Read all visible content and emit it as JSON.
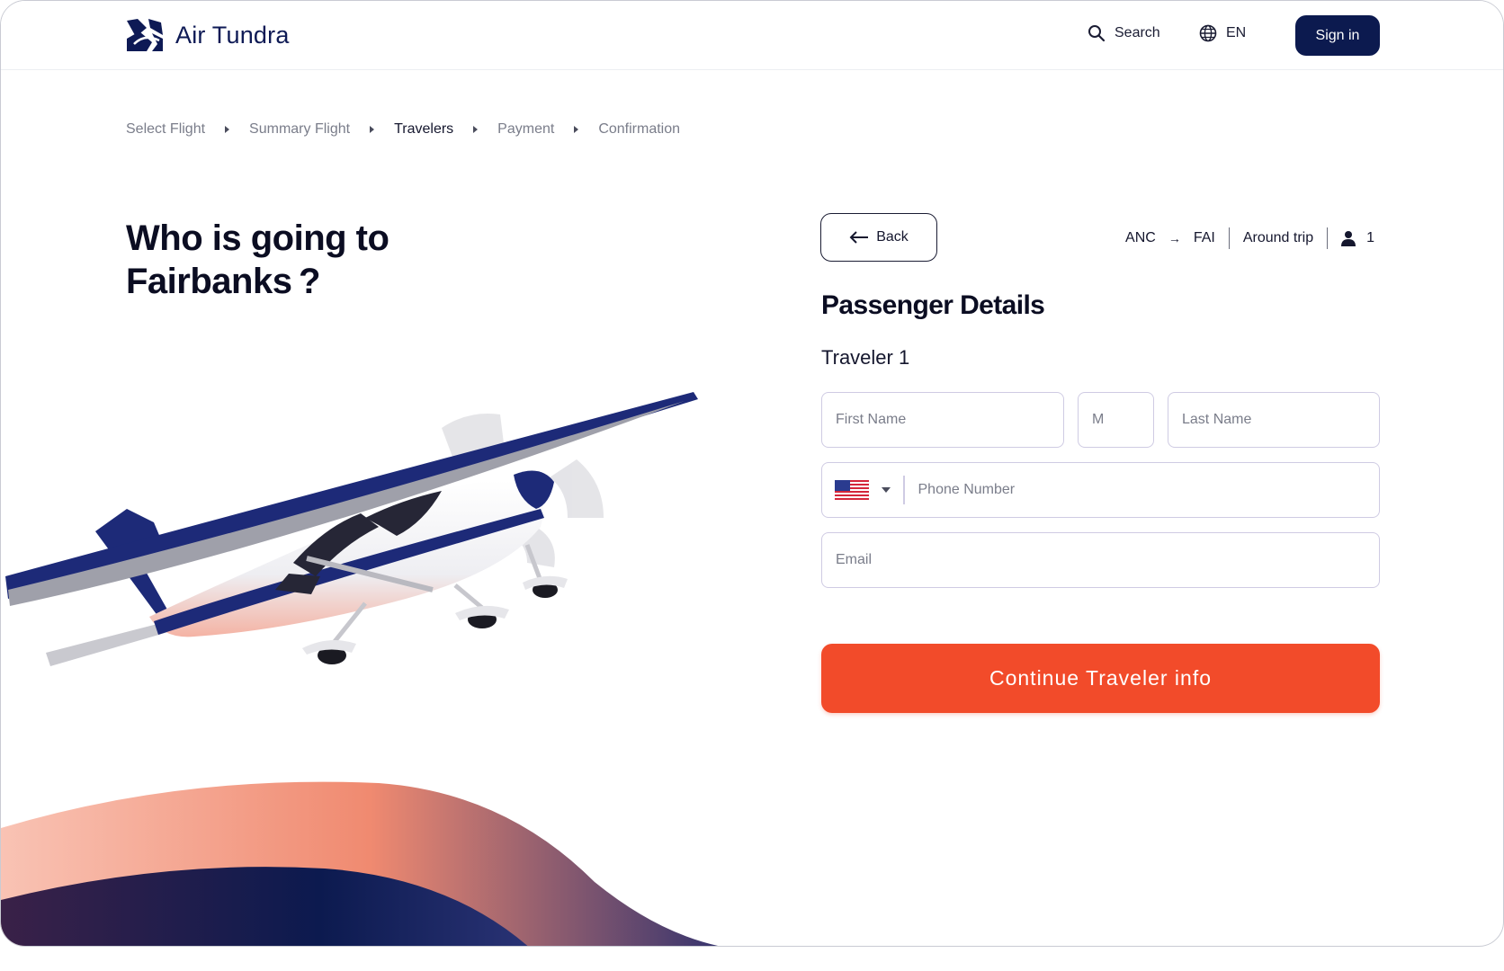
{
  "brand": {
    "name": "Air Tundra",
    "color": "#0c1a4f",
    "accent": "#f24b2a"
  },
  "header": {
    "search_label": "Search",
    "search_icon": "search-icon",
    "language_label": "EN",
    "language_icon": "globe-icon",
    "signin_label": "Sign in"
  },
  "breadcrumb": {
    "items": [
      {
        "label": "Select Flight",
        "active": false
      },
      {
        "label": "Summary Flight",
        "active": false
      },
      {
        "label": "Travelers",
        "active": true
      },
      {
        "label": "Payment",
        "active": false
      },
      {
        "label": "Confirmation",
        "active": false
      }
    ]
  },
  "hero": {
    "title_line1": "Who is going to",
    "title_line2": "Fairbanks ?"
  },
  "trip": {
    "back_label": "Back",
    "origin": "ANC",
    "arrow": "→",
    "destination": "FAI",
    "trip_type": "Around trip",
    "passengers": "1"
  },
  "form": {
    "title": "Passenger Details",
    "traveler_label": "Traveler 1",
    "first_name_placeholder": "First Name",
    "middle_placeholder": "M",
    "last_name_placeholder": "Last Name",
    "country_flag": "us-flag-icon",
    "phone_placeholder": "Phone Number",
    "email_placeholder": "Email",
    "submit_label": "Continue Traveler info"
  }
}
